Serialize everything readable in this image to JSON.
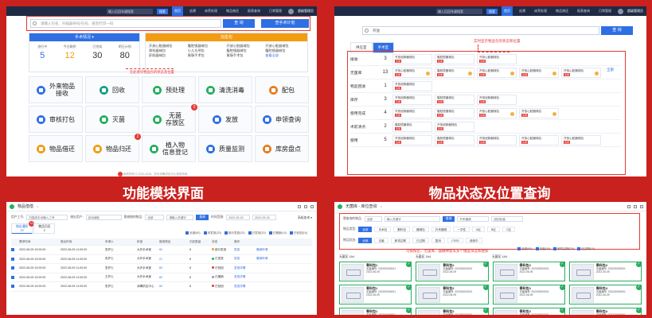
{
  "titles": {
    "left": "功能模块界面",
    "right": "物品状态及位置查询"
  },
  "topbar": {
    "search_placeholder": "输入后回车键搜索",
    "search_btn": "搜索",
    "nav": [
      "首页",
      "追溯",
      "床旁处理",
      "物品借还",
      "报表查询",
      "日常管理"
    ],
    "user": "超级管理员"
  },
  "p1": {
    "search_placeholder": "请输入包名、扫描器条码/包号、纸签打印一码",
    "search_btn": "查 询",
    "plan_btn": "查手术计划",
    "manual": {
      "title": "手术情况 ▾",
      "stats": [
        {
          "label": "进行中",
          "value": "5"
        },
        {
          "label": "今日剩余",
          "value": "12"
        },
        {
          "label": "已完成",
          "value": "30"
        },
        {
          "label": "明日计划",
          "value": "80"
        }
      ]
    },
    "urgent": {
      "title": "加急包",
      "cols": [
        [
          "开放心脏器械包",
          "骨科器械包",
          "肝胆器械包"
        ],
        [
          "腹腔镜器械包",
          "小儿头颅包",
          "胃肠手术包"
        ],
        [
          "开放心脏器械包",
          "腹腔镜器械包",
          "胃肠手术包"
        ],
        [
          "开放心脏器械包",
          "腹腔镜器械包",
          "查看全部"
        ]
      ]
    },
    "note": "在此查询物品包的状态及位置",
    "tiles": [
      {
        "label": "外来物品\n接收",
        "color": "#2f6fe4"
      },
      {
        "label": "回收",
        "color": "#16a085"
      },
      {
        "label": "预处理",
        "color": "#27ae60"
      },
      {
        "label": "清洗消毒",
        "color": "#27ae60"
      },
      {
        "label": "配包",
        "color": "#e67e22"
      },
      {
        "label": "审核打包",
        "color": "#2f6fe4"
      },
      {
        "label": "灭菌",
        "color": "#27ae60"
      },
      {
        "label": "无菌\n存放区",
        "color": "#27ae60",
        "badge": "3"
      },
      {
        "label": "发放",
        "color": "#2f6fe4"
      },
      {
        "label": "申领查询",
        "color": "#2f6fe4"
      },
      {
        "label": "物品借还",
        "color": "#f39c12"
      },
      {
        "label": "物品归还",
        "color": "#f39c12",
        "badge": "2"
      },
      {
        "label": "植入物\n信息登记",
        "color": "#27ae60"
      },
      {
        "label": "质量监测",
        "color": "#2f6fe4"
      },
      {
        "label": "库房盘点",
        "color": "#e67e22"
      }
    ],
    "footer": "版权所有 © 2020-2026 · 苏州消毒供应中心信息系统"
  },
  "p2": {
    "search_value": "开放",
    "search_btn": "查 询",
    "tabs": [
      "供应室",
      "手术室"
    ],
    "note": "实时显示物品包的状态和位置",
    "more": "全部",
    "rows": [
      {
        "name": "接收",
        "count": "3",
        "items": [
          "开放冠脉器械包",
          "腹腔镜器械包",
          "开放心脏器械包"
        ]
      },
      {
        "name": "无菌库",
        "count": "13",
        "items": [
          "开放心脏器械包",
          "腹腔镜器械包",
          "开放心脏器械包",
          "开放心脏器械包",
          "开放心脏器械包"
        ]
      },
      {
        "name": "物品回收",
        "count": "1",
        "items": [
          "开放冠脉器械包"
        ]
      },
      {
        "name": "库存",
        "count": "3",
        "items": [
          "开放冠脉器械包",
          "腹腔镜器械包",
          "开放冠脉器械包"
        ]
      },
      {
        "name": "使用完成",
        "count": "4",
        "items": [
          "开放冠脉器械包",
          "腹腔镜器械包",
          "开放心脏器械包",
          "开放心脏器械包"
        ]
      },
      {
        "name": "术前清点",
        "count": "2",
        "items": [
          "腹腔镜器械包",
          "开放冠脉器械包"
        ]
      },
      {
        "name": "使用",
        "count": "5",
        "items": [
          "开放冠脉器械包",
          "腹腔镜器械包",
          "开放冠脉器械包",
          "开放心脏器械包",
          "开放心脏器械包"
        ]
      }
    ],
    "tag": "急用"
  },
  "p3": {
    "title": "物品借借",
    "filters": {
      "l1": "用户工号:",
      "v1": "扫描或手动输入工号",
      "l2": "借出用户:",
      "v2": "自动读取",
      "l3": "需借借的物品:",
      "v3": "全部",
      "l4": "请输入关键字",
      "btn": "查询",
      "l5": "时间范围:",
      "v5": "2022-05-30",
      "v6": "2022-05-30",
      "more": "高级查询 ▾"
    },
    "tabs": [
      {
        "label": "借出通知",
        "badge": "10",
        "sub": "20"
      },
      {
        "label": "物品归还",
        "sub": "2"
      }
    ],
    "legend": [
      "全部(80)",
      "未发放(20)",
      "部分发放(20)",
      "已发放(20)",
      "已撤销(10)",
      "已驳回(10)"
    ],
    "headers": [
      "",
      "需求时间",
      "借出时间",
      "申请人",
      "科室",
      "借用物品",
      "归还数量",
      "状态",
      "操作",
      ""
    ],
    "rows": [
      [
        "2022-06-09 10:00:00",
        "2022-06-09 11:00:00",
        "张护士",
        "大外手术室",
        "60",
        "8",
        "部分发放",
        "发放",
        "撤销申请",
        "#f39c12"
      ],
      [
        "2022-06-09 10:00:00",
        "2022-06-09 11:00:00",
        "张护士",
        "大外手术室",
        "21",
        "8",
        "已发放",
        "发放",
        "撤销申请",
        "#27ae60"
      ],
      [
        "2022-06-09 10:00:00",
        "2022-06-09 11:00:00",
        "张护士",
        "大外手术室",
        "60",
        "8",
        "已驳回",
        "发放详情",
        "",
        "#e53935"
      ],
      [
        "2022-06-09 10:00:00",
        "2022-06-09 11:00:00",
        "王护士",
        "大外手术室",
        "60",
        "8",
        "已撤销",
        "发放详情",
        "",
        "#999999"
      ],
      [
        "2022-06-09 10:00:00",
        "2022-06-09 11:00:00",
        "张护士",
        "消毒供应中心",
        "60",
        "8",
        "已驳回",
        "发放详情",
        "",
        "#e53935"
      ]
    ]
  },
  "p4": {
    "title": "无菌库 - 库位查询",
    "row1": {
      "label": "需查询的物品:",
      "v1": "全部",
      "ph": "输入关键字",
      "btn": "查询",
      "tags": [
        "开来器械",
        "回回包装"
      ]
    },
    "row2": {
      "label": "物品类型:",
      "pills": [
        "全部",
        "手术包",
        "敷料包",
        "器械包",
        "外来器械",
        "一次性",
        "A区",
        "B区",
        "C区"
      ]
    },
    "row3": {
      "label": "物品状态:",
      "pills": [
        "全部",
        "无菌",
        "即将过期",
        "已过期",
        "复消",
        "CSSD",
        "使用中"
      ]
    },
    "note": "可按按区、无菌库、器械种类等多个维度筛选和搜索",
    "opts": [
      "全部(80)",
      "无菌(20)",
      "即将过期(20)",
      "已过期(10)"
    ],
    "sub": [
      "无菌区 1A4",
      "无菌区 1A4",
      "无菌区 1A4"
    ],
    "cards": [
      {
        "name": "骨科包1",
        "a": "无菌编号: 202200000001",
        "b": "2022-06-09"
      },
      {
        "name": "骨科包2",
        "a": "无菌编号: 202200000001",
        "b": "2022-06-09"
      },
      {
        "name": "骨科包3",
        "a": "无菌编号: 202200000001",
        "b": "2022-06-09"
      },
      {
        "name": "骨科包4",
        "a": "无菌编号: 202200000001",
        "b": "2022-06-09"
      },
      {
        "name": "骨科包1",
        "a": "无菌编号: 202200000001",
        "b": "2022-06-09"
      },
      {
        "name": "骨科包2",
        "a": "无菌编号: 202200000001",
        "b": "2022-06-09"
      },
      {
        "name": "骨科包3",
        "a": "无菌编号: 202200000001",
        "b": "2022-06-09"
      },
      {
        "name": "骨科包4",
        "a": "无菌编号: 202200000001",
        "b": "2022-06-09"
      },
      {
        "name": "骨科包1",
        "a": "无菌编号: 202200000001",
        "b": "2022-06-09"
      },
      {
        "name": "骨科包2",
        "a": "无菌编号: 202200000001",
        "b": "2022-06-09"
      },
      {
        "name": "骨科包3",
        "a": "无菌编号: 202200000001",
        "b": "2022-06-09"
      },
      {
        "name": "骨科包4",
        "a": "无菌编号: 202200000001",
        "b": "2022-06-09"
      }
    ]
  }
}
